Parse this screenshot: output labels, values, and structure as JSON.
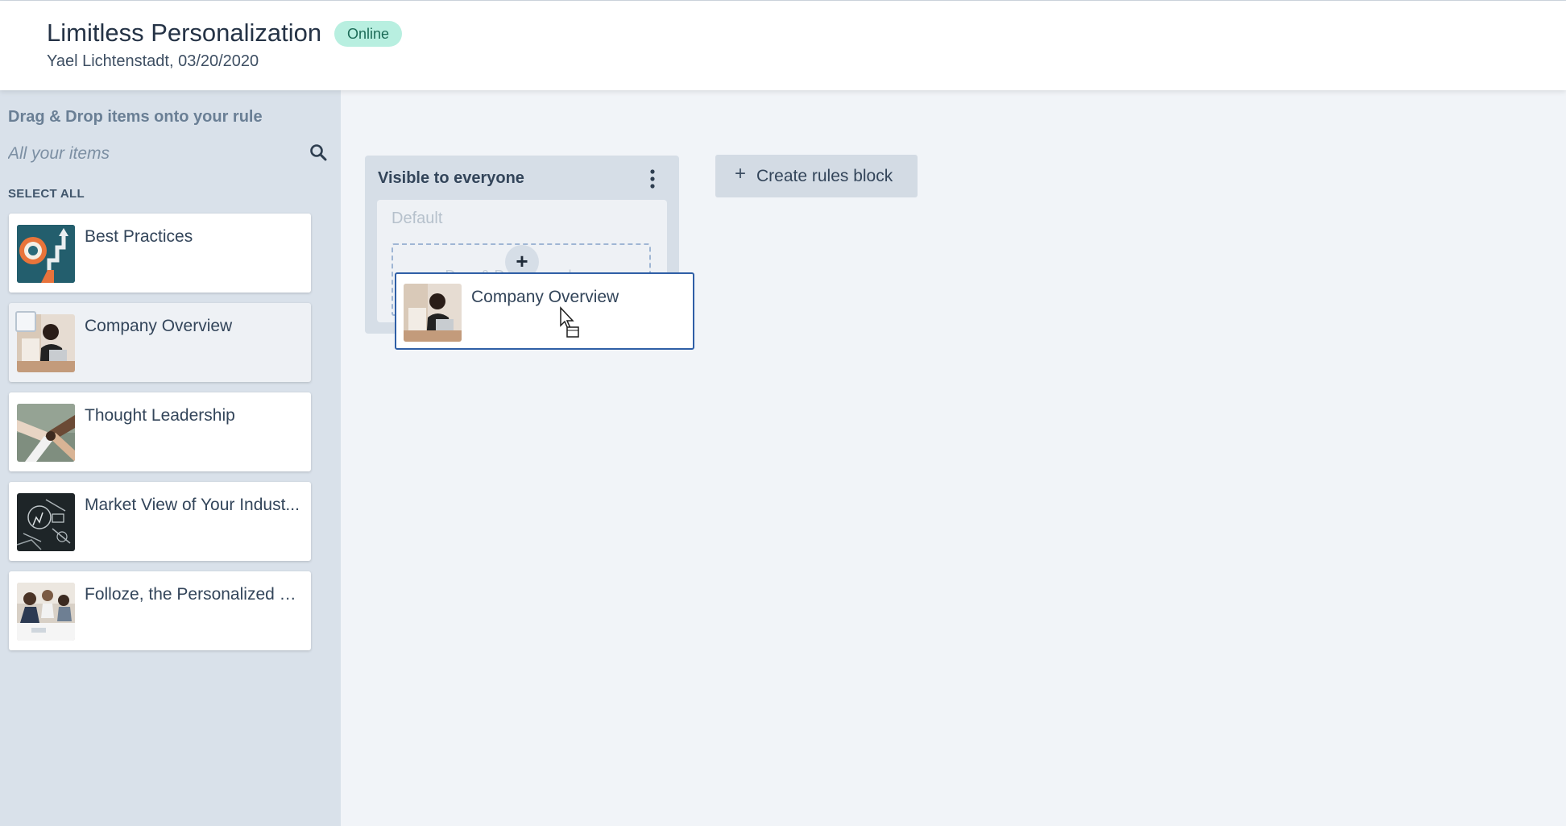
{
  "header": {
    "title": "Limitless Personalization",
    "status_badge": "Online",
    "subtitle": "Yael Lichtenstadt, 03/20/2020"
  },
  "sidebar": {
    "heading": "Drag & Drop items onto your rule",
    "search_placeholder": "All your items",
    "select_all": "SELECT ALL",
    "items": [
      {
        "label": "Best Practices"
      },
      {
        "label": "Company Overview"
      },
      {
        "label": "Thought Leadership"
      },
      {
        "label": "Market View of Your Indust..."
      },
      {
        "label": "Folloze, the Personalized B..."
      }
    ]
  },
  "rules": {
    "block_title": "Visible to everyone",
    "default_label": "Default",
    "drop_zone_text": "Drag & Drop items here",
    "create_button": "Create rules block"
  },
  "drag_ghost": {
    "label": "Company Overview"
  },
  "colors": {
    "accent": "#2f5fa6",
    "badge_bg": "#b8efe0",
    "sidebar_bg": "#d9e1ea",
    "canvas_bg": "#f1f4f8"
  }
}
